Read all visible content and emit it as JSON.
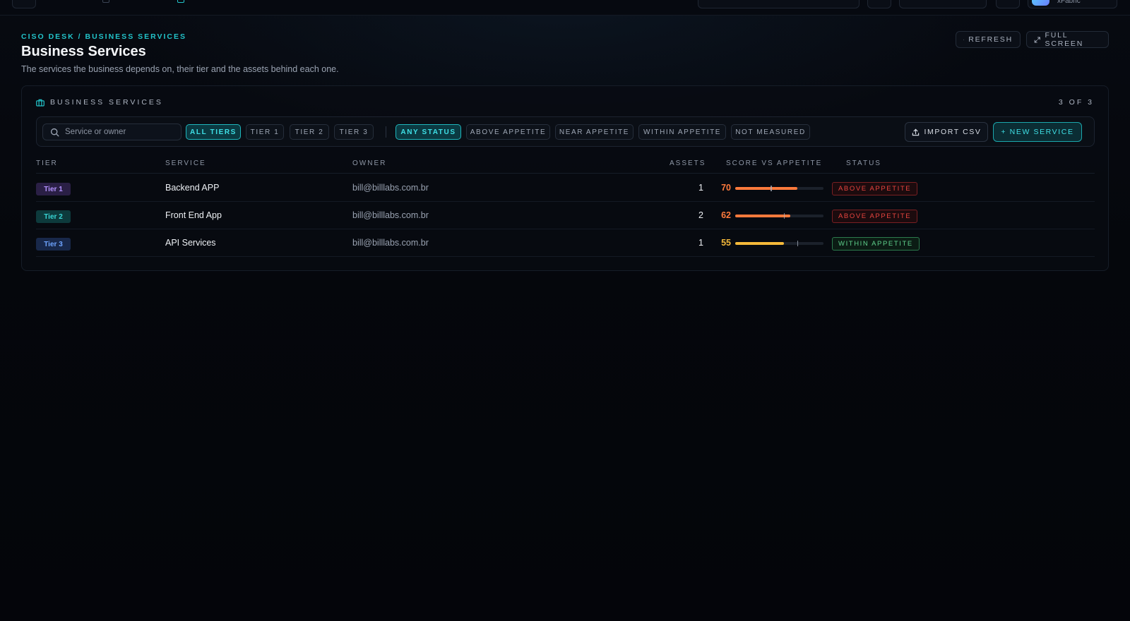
{
  "topbar": {
    "user_label": "xFabric"
  },
  "header": {
    "breadcrumb": "CISO DESK / BUSINESS SERVICES",
    "title": "Business Services",
    "subtitle": "The services the business depends on, their tier and the assets behind each one.",
    "refresh_label": "REFRESH",
    "fullscreen_label": "FULL SCREEN"
  },
  "panel": {
    "title": "BUSINESS SERVICES",
    "count": "3 OF 3"
  },
  "filters": {
    "search_placeholder": "Service or owner",
    "search_value": "",
    "tier_chips": [
      "ALL TIERS",
      "TIER 1",
      "TIER 2",
      "TIER 3"
    ],
    "tier_selected": "ALL TIERS",
    "status_chips": [
      "ANY STATUS",
      "ABOVE APPETITE",
      "NEAR APPETITE",
      "WITHIN APPETITE",
      "NOT MEASURED"
    ],
    "status_selected": "ANY STATUS",
    "import_label": "IMPORT CSV",
    "new_label": "+ NEW SERVICE"
  },
  "table": {
    "columns": [
      "TIER",
      "SERVICE",
      "OWNER",
      "ASSETS",
      "SCORE VS APPETITE",
      "STATUS"
    ],
    "rows": [
      {
        "tier": "Tier 1",
        "service": "Backend APP",
        "owner": "bill@billlabs.com.br",
        "assets": "1",
        "score": "70",
        "score_fraction": 0.7,
        "appetite_fraction": 0.4,
        "status": "ABOVE APPETITE"
      },
      {
        "tier": "Tier 2",
        "service": "Front End App",
        "owner": "bill@billlabs.com.br",
        "assets": "2",
        "score": "62",
        "score_fraction": 0.62,
        "appetite_fraction": 0.55,
        "status": "ABOVE APPETITE"
      },
      {
        "tier": "Tier 3",
        "service": "API Services",
        "owner": "bill@billlabs.com.br",
        "assets": "1",
        "score": "55",
        "score_fraction": 0.55,
        "appetite_fraction": 0.7,
        "status": "WITHIN APPETITE"
      }
    ]
  },
  "colors": {
    "accent": "#22c3c9",
    "tier1_bg": "#2a1f45",
    "tier1_fg": "#b392ff",
    "tier2_bg": "#0d3a3c",
    "tier2_fg": "#38d6d6",
    "tier3_bg": "#18284a",
    "tier3_fg": "#6ea4ff",
    "above_fg": "#e8443f",
    "above_border": "#7a1f22",
    "above_bg": "#1c0b0e",
    "within_fg": "#5fd08c",
    "within_border": "#2c7a4c",
    "within_bg": "#0b1c14",
    "score_high": "#ff7a3c",
    "score_mid": "#f5b93a"
  }
}
